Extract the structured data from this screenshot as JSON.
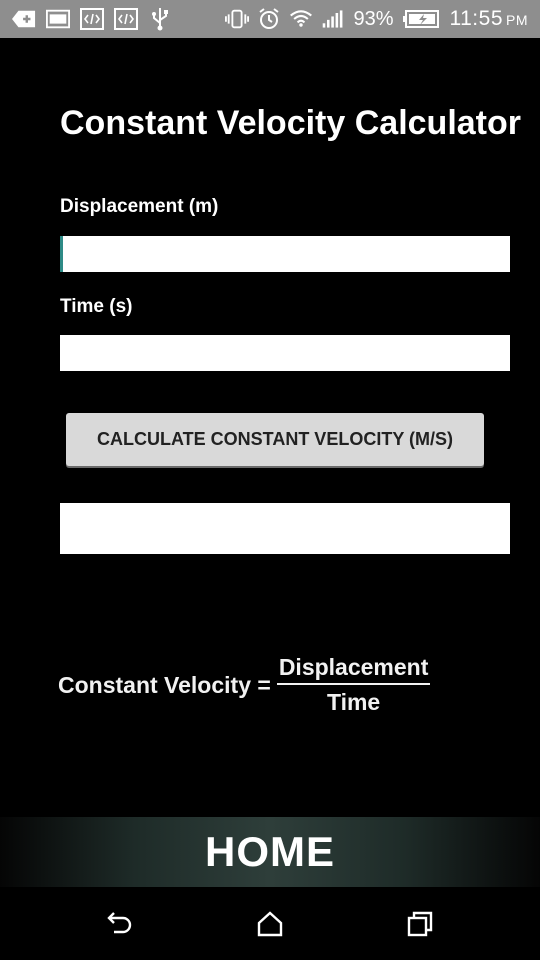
{
  "status_bar": {
    "battery_percent": "93%",
    "time": "11:55",
    "ampm": "PM",
    "icons": [
      "add-icon",
      "image-icon",
      "code-icon",
      "code-icon",
      "usb-icon",
      "vibrate-icon",
      "alarm-icon",
      "wifi-icon",
      "signal-icon",
      "battery-charging-icon"
    ]
  },
  "app": {
    "title": "Constant Velocity Calculator",
    "displacement_label": "Displacement (m)",
    "displacement_value": "",
    "time_label": "Time (s)",
    "time_value": "",
    "calculate_button": "CALCULATE CONSTANT VELOCITY (M/S)",
    "result_value": "",
    "formula": {
      "lhs": "Constant Velocity =",
      "numerator": "Displacement",
      "denominator": "Time"
    },
    "home_label": "HOME"
  },
  "navigation": {
    "icons": [
      "back-icon",
      "home-icon",
      "recents-icon"
    ]
  },
  "colors": {
    "status_bar": "#8e8e8e",
    "background": "#000000",
    "button": "#d9d9d9",
    "focus_accent": "#2e8b87"
  }
}
